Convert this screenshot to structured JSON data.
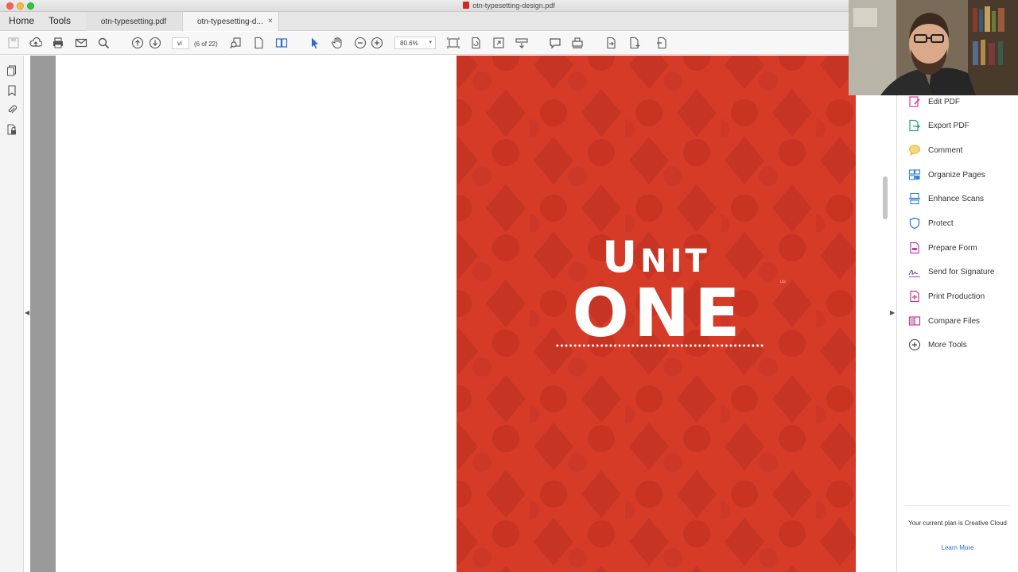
{
  "window": {
    "title": "otn-typesetting-design.pdf"
  },
  "nav": {
    "home": "Home",
    "tools": "Tools"
  },
  "tabs": [
    {
      "label": "otn-typesetting.pdf"
    },
    {
      "label": "otn-typesetting-d...",
      "close": "×"
    }
  ],
  "toolbar": {
    "page_value": "vi",
    "page_count": "(6 of 22)",
    "zoom_value": "80.6%",
    "zoom_caret": "▾"
  },
  "document": {
    "heading_unit_first": "U",
    "heading_unit_rest": "NIT",
    "heading_one": "ONE",
    "stray_mark": "uu",
    "colors": {
      "page_red": "#d53b26",
      "pattern_red": "#c93322"
    }
  },
  "tools_pane": {
    "items": [
      {
        "label": "Edit PDF",
        "icon": "edit-pdf-icon",
        "color": "#d63aa5"
      },
      {
        "label": "Export PDF",
        "icon": "export-pdf-icon",
        "color": "#1aa37a"
      },
      {
        "label": "Comment",
        "icon": "comment-icon",
        "color": "#f0b32b"
      },
      {
        "label": "Organize Pages",
        "icon": "organize-pages-icon",
        "color": "#2e7fd6"
      },
      {
        "label": "Enhance Scans",
        "icon": "enhance-scans-icon",
        "color": "#2e7fd6"
      },
      {
        "label": "Protect",
        "icon": "protect-icon",
        "color": "#2e7fd6"
      },
      {
        "label": "Prepare Form",
        "icon": "prepare-form-icon",
        "color": "#b93fb0"
      },
      {
        "label": "Send for Signature",
        "icon": "signature-icon",
        "color": "#7a52c7"
      },
      {
        "label": "Print Production",
        "icon": "print-production-icon",
        "color": "#c23a8f"
      },
      {
        "label": "Compare Files",
        "icon": "compare-files-icon",
        "color": "#c23a8f"
      },
      {
        "label": "More Tools",
        "icon": "more-tools-icon",
        "color": "#444444"
      }
    ],
    "plan_text": "Your current plan is Creative Cloud",
    "learn_more": "Learn More"
  }
}
